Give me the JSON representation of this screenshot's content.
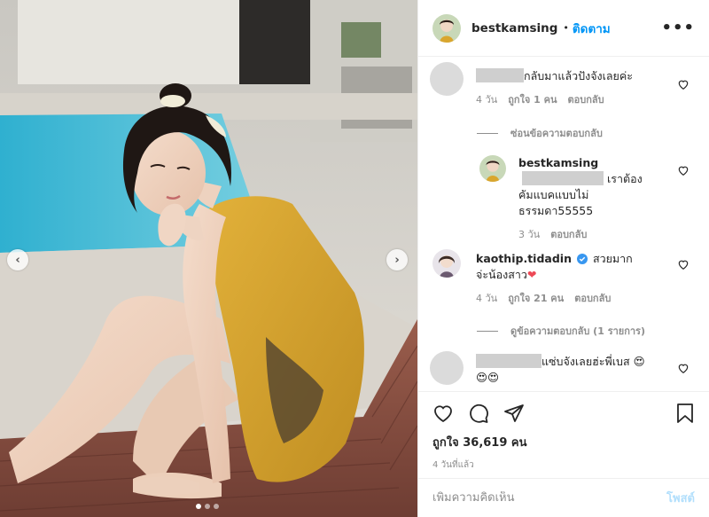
{
  "header": {
    "username": "bestkamsing",
    "separator": "•",
    "follow_label": "ติดตาม",
    "more_icon": "more-icon",
    "more_glyph": "•••"
  },
  "media": {
    "prev_glyph": "‹",
    "next_glyph": "›",
    "slide_count": 3,
    "active_slide": 1
  },
  "comments": [
    {
      "text": "กลับมาแล้วปังจังเลยค่ะ",
      "time": "4 วัน",
      "likes": "ถูกใจ 1 คน",
      "reply": "ตอบกลับ"
    },
    {
      "thread_label": "ซ่อนข้อความตอบกลับ"
    },
    {
      "username": "bestkamsing",
      "text": "เราต้องคัมแบคแบบไม่ธรรมดา55555",
      "time": "3 วัน",
      "reply": "ตอบกลับ"
    },
    {
      "username": "kaothip.tidadin",
      "text": "สวยมากจ่ะน้องสาว",
      "heart_emoji": "❤",
      "time": "4 วัน",
      "likes": "ถูกใจ 21 คน",
      "reply": "ตอบกลับ"
    },
    {
      "thread_label": "ดูข้อความตอบกลับ (1 รายการ)"
    },
    {
      "text": "แซ่บจังเลยฮ่ะพี่เบส",
      "emoji": "😍",
      "emoji_line2": "😍😍"
    }
  ],
  "actions": {
    "likes_text": "ถูกใจ 36,619 คน",
    "time_text": "4 วันที่แล้ว"
  },
  "add_comment": {
    "placeholder": "เพิ่มความคิดเห็น",
    "post_label": "โพสต์"
  },
  "colors": {
    "accent": "#0095f6",
    "post_disabled": "#b2dffc",
    "swimsuit": "#d9a62e",
    "pool": "#3ab5d3",
    "heart_red": "#ed4956"
  }
}
